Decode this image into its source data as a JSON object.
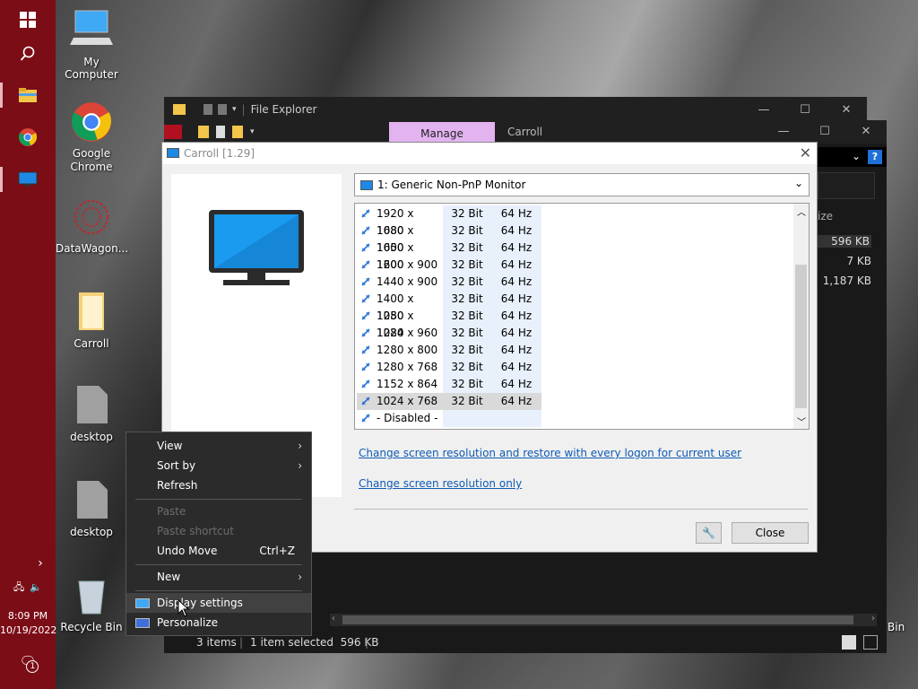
{
  "taskbar": {
    "time": "8:09 PM",
    "date": "10/19/2022",
    "notification_count": "1"
  },
  "desktop_icons": [
    {
      "label": "My Computer"
    },
    {
      "label": "Google Chrome"
    },
    {
      "label": "DataWagon..."
    },
    {
      "label": "Carroll"
    },
    {
      "label": "desktop"
    },
    {
      "label": "desktop"
    },
    {
      "label": "Recycle Bin"
    },
    {
      "label": "Bin"
    }
  ],
  "file_explorer": {
    "back_title": "File Explorer",
    "manage_tab": "Manage",
    "folder_tab": "Carroll",
    "column_header": "ize",
    "sizes": [
      "596 KB",
      "7 KB",
      "1,187 KB"
    ],
    "status": {
      "items": "3 items",
      "selected": "1 item selected  596 KB"
    }
  },
  "dialog": {
    "title": "Carroll [1.29]",
    "monitor": "1: Generic Non-PnP Monitor",
    "modes": [
      {
        "res": "1920 x 1080",
        "bit": "32 Bit",
        "hz": "64 Hz"
      },
      {
        "res": "1680 x 1050",
        "bit": "32 Bit",
        "hz": "64 Hz"
      },
      {
        "res": "1600 x 1200",
        "bit": "32 Bit",
        "hz": "64 Hz"
      },
      {
        "res": "1600 x 900",
        "bit": "32 Bit",
        "hz": "64 Hz"
      },
      {
        "res": "1440 x 900",
        "bit": "32 Bit",
        "hz": "64 Hz"
      },
      {
        "res": "1400 x 1050",
        "bit": "32 Bit",
        "hz": "64 Hz"
      },
      {
        "res": "1280 x 1024",
        "bit": "32 Bit",
        "hz": "64 Hz"
      },
      {
        "res": "1280 x 960",
        "bit": "32 Bit",
        "hz": "64 Hz"
      },
      {
        "res": "1280 x 800",
        "bit": "32 Bit",
        "hz": "64 Hz"
      },
      {
        "res": "1280 x 768",
        "bit": "32 Bit",
        "hz": "64 Hz"
      },
      {
        "res": "1152 x 864",
        "bit": "32 Bit",
        "hz": "64 Hz"
      },
      {
        "res": "1024 x 768",
        "bit": "32 Bit",
        "hz": "64 Hz"
      },
      {
        "res": "- Disabled -",
        "bit": "",
        "hz": ""
      }
    ],
    "selected_mode": "1024 x 768",
    "link_restore": "Change screen resolution and restore with every logon for current user",
    "link_only": "Change screen resolution only",
    "close_label": "Close"
  },
  "context_menu": {
    "view": "View",
    "sort_by": "Sort by",
    "refresh": "Refresh",
    "paste": "Paste",
    "paste_shortcut": "Paste shortcut",
    "undo_move": "Undo Move",
    "undo_shortcut": "Ctrl+Z",
    "new": "New",
    "display_settings": "Display settings",
    "personalize": "Personalize"
  },
  "colors": {
    "taskbar": "#7b0d16",
    "manage_tab": "#e3b3f0",
    "link": "#0f5bb5"
  }
}
